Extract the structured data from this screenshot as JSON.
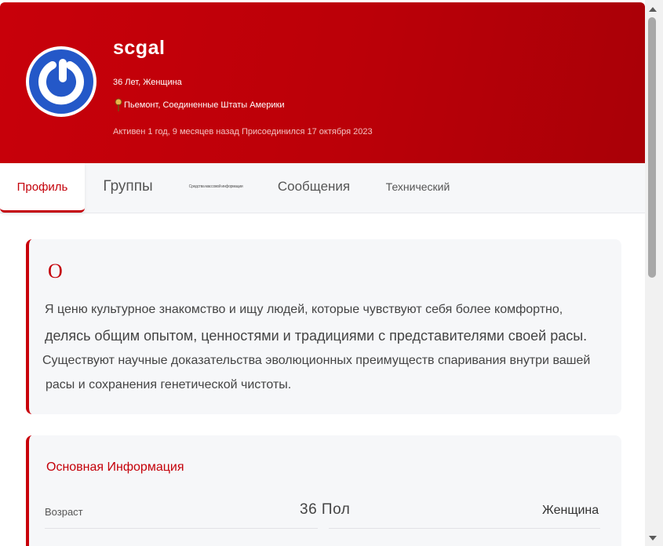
{
  "profile": {
    "username": "scgal",
    "age_gender": "36 Лет, Женщина",
    "location": "Пьемонт, Соединенные Штаты Америки",
    "activity": "Активен 1 год, 9 месяцев назад Присоединился 17 октября 2023"
  },
  "tabs": [
    {
      "label": "Профиль",
      "active": true
    },
    {
      "label": "Группы",
      "active": false
    },
    {
      "label": "Средства массовой информации",
      "active": false
    },
    {
      "label": "Сообщения",
      "active": false
    },
    {
      "label": "Технический",
      "active": false
    }
  ],
  "about": {
    "title": "О",
    "lines": [
      "Я ценю культурное знакомство и ищу людей, которые чувствуют себя более комфортно,",
      "делясь общим опытом, ценностями и традициями с представителями своей расы.",
      "Существуют научные доказательства эволюционных преимуществ спаривания внутри вашей",
      "расы и сохранения генетической чистоты."
    ]
  },
  "basic_info": {
    "title": "Основная Информация",
    "age_label": "Возраст",
    "age_value": "36 Пол",
    "gender_value": "Женщина"
  },
  "colors": {
    "brand_red": "#c40009",
    "avatar_blue": "#2458c8"
  }
}
